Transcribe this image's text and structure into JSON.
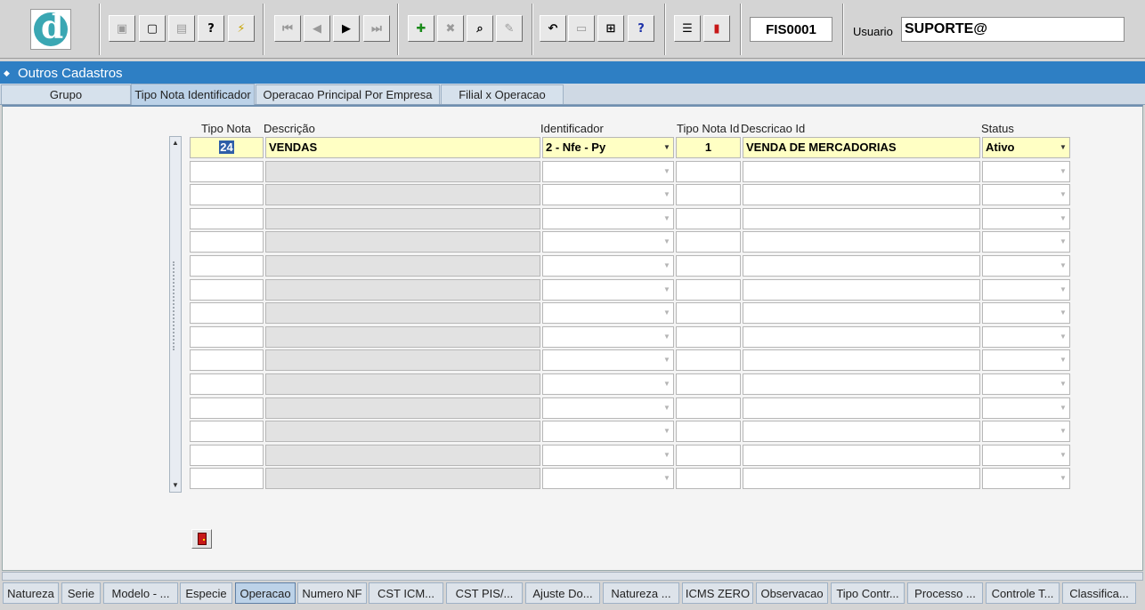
{
  "toolbar": {
    "logo_letter": "d",
    "buttons": [
      {
        "name": "save-button",
        "glyph": "▣",
        "dim": true
      },
      {
        "name": "window-button",
        "glyph": "▢",
        "dim": false
      },
      {
        "name": "print-button",
        "glyph": "▤",
        "dim": true
      },
      {
        "name": "query-help-button",
        "glyph": "?",
        "dim": false
      },
      {
        "name": "execute-query-button",
        "glyph": "⚡",
        "dim": false
      },
      {
        "name": "first-record-button",
        "glyph": "⏮",
        "dim": true
      },
      {
        "name": "previous-record-button",
        "glyph": "◀",
        "dim": true
      },
      {
        "name": "next-record-button",
        "glyph": "▶",
        "dim": false
      },
      {
        "name": "last-record-button",
        "glyph": "⏭",
        "dim": true
      },
      {
        "name": "insert-record-button",
        "glyph": "✚",
        "dim": false
      },
      {
        "name": "delete-record-button",
        "glyph": "✖",
        "dim": true
      },
      {
        "name": "search-record-button",
        "glyph": "⌕",
        "dim": false
      },
      {
        "name": "edit-record-button",
        "glyph": "✎",
        "dim": true
      },
      {
        "name": "undo-button",
        "glyph": "↶",
        "dim": false
      },
      {
        "name": "clipboard-button",
        "glyph": "▭",
        "dim": true
      },
      {
        "name": "calculator-button",
        "glyph": "⊞",
        "dim": false
      },
      {
        "name": "help-button",
        "glyph": "?",
        "dim": false
      },
      {
        "name": "menu-button",
        "glyph": "☰",
        "dim": false
      },
      {
        "name": "exit-button",
        "glyph": "▮",
        "dim": false
      }
    ],
    "form_code": "FIS0001",
    "user_label": "Usuario",
    "user_value": "SUPORTE@"
  },
  "window": {
    "title": "Outros Cadastros"
  },
  "top_tabs": [
    {
      "label": "Grupo",
      "active": false
    },
    {
      "label": "Tipo Nota Identificador",
      "active": true
    },
    {
      "label": "Operacao Principal Por Empresa",
      "active": false
    },
    {
      "label": "Filial x Operacao",
      "active": false
    }
  ],
  "grid": {
    "headers": {
      "tipo_nota": "Tipo Nota",
      "descricao": "Descrição",
      "identificador": "Identificador",
      "tipo_nota_id": "Tipo Nota Id",
      "descricao_id": "Descricao Id",
      "status": "Status"
    },
    "rows": [
      {
        "tipo_nota": "24",
        "descricao": "VENDAS",
        "identificador": "2 - Nfe - Py",
        "tipo_nota_id": "1",
        "descricao_id": "VENDA DE MERCADORIAS",
        "status": "Ativo"
      },
      {
        "tipo_nota": "",
        "descricao": "",
        "identificador": "",
        "tipo_nota_id": "",
        "descricao_id": "",
        "status": ""
      },
      {
        "tipo_nota": "",
        "descricao": "",
        "identificador": "",
        "tipo_nota_id": "",
        "descricao_id": "",
        "status": ""
      },
      {
        "tipo_nota": "",
        "descricao": "",
        "identificador": "",
        "tipo_nota_id": "",
        "descricao_id": "",
        "status": ""
      },
      {
        "tipo_nota": "",
        "descricao": "",
        "identificador": "",
        "tipo_nota_id": "",
        "descricao_id": "",
        "status": ""
      },
      {
        "tipo_nota": "",
        "descricao": "",
        "identificador": "",
        "tipo_nota_id": "",
        "descricao_id": "",
        "status": ""
      },
      {
        "tipo_nota": "",
        "descricao": "",
        "identificador": "",
        "tipo_nota_id": "",
        "descricao_id": "",
        "status": ""
      },
      {
        "tipo_nota": "",
        "descricao": "",
        "identificador": "",
        "tipo_nota_id": "",
        "descricao_id": "",
        "status": ""
      },
      {
        "tipo_nota": "",
        "descricao": "",
        "identificador": "",
        "tipo_nota_id": "",
        "descricao_id": "",
        "status": ""
      },
      {
        "tipo_nota": "",
        "descricao": "",
        "identificador": "",
        "tipo_nota_id": "",
        "descricao_id": "",
        "status": ""
      },
      {
        "tipo_nota": "",
        "descricao": "",
        "identificador": "",
        "tipo_nota_id": "",
        "descricao_id": "",
        "status": ""
      },
      {
        "tipo_nota": "",
        "descricao": "",
        "identificador": "",
        "tipo_nota_id": "",
        "descricao_id": "",
        "status": ""
      },
      {
        "tipo_nota": "",
        "descricao": "",
        "identificador": "",
        "tipo_nota_id": "",
        "descricao_id": "",
        "status": ""
      },
      {
        "tipo_nota": "",
        "descricao": "",
        "identificador": "",
        "tipo_nota_id": "",
        "descricao_id": "",
        "status": ""
      },
      {
        "tipo_nota": "",
        "descricao": "",
        "identificador": "",
        "tipo_nota_id": "",
        "descricao_id": "",
        "status": ""
      }
    ]
  },
  "bottom_tabs": [
    {
      "label": "Natureza",
      "active": false
    },
    {
      "label": "Serie",
      "active": false
    },
    {
      "label": "Modelo - ...",
      "active": false
    },
    {
      "label": "Especie",
      "active": false
    },
    {
      "label": "Operacao",
      "active": true
    },
    {
      "label": "Numero NF",
      "active": false
    },
    {
      "label": "CST ICM...",
      "active": false
    },
    {
      "label": "CST PIS/...",
      "active": false
    },
    {
      "label": "Ajuste Do...",
      "active": false
    },
    {
      "label": "Natureza ...",
      "active": false
    },
    {
      "label": "ICMS ZERO",
      "active": false
    },
    {
      "label": "Observacao",
      "active": false
    },
    {
      "label": "Tipo Contr...",
      "active": false
    },
    {
      "label": "Processo ...",
      "active": false
    },
    {
      "label": "Controle T...",
      "active": false
    },
    {
      "label": "Classifica...",
      "active": false
    }
  ],
  "colors": {
    "accent": "#2e7fc4",
    "highlight": "#ffffc4",
    "selection": "#2e5ea8"
  }
}
